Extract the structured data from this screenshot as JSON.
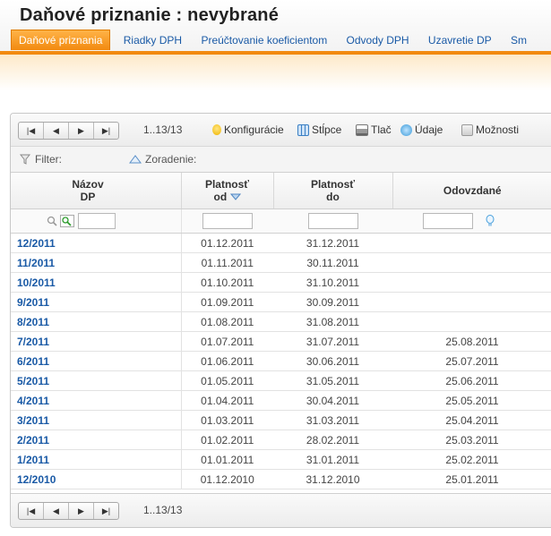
{
  "page": {
    "title": "Daňové priznanie :  nevybrané"
  },
  "tabs": [
    {
      "label": "Daňové priznania",
      "active": true
    },
    {
      "label": "Riadky DPH"
    },
    {
      "label": "Preúčtovanie koeficientom"
    },
    {
      "label": "Odvody DPH"
    },
    {
      "label": "Uzavretie DP"
    },
    {
      "label": "Sm"
    }
  ],
  "toolbar": {
    "range": "1..13/13",
    "config_label": "Konfigurácie",
    "columns_label": "Stĺpce",
    "print_label": "Tlač",
    "data_label": "Údaje",
    "options_label": "Možnosti",
    "pager_icons": [
      "first-page-icon",
      "prev-page-icon",
      "next-page-icon",
      "last-page-icon"
    ]
  },
  "filterbar": {
    "filter_label": "Filter:",
    "sort_label": "Zoradenie:"
  },
  "table": {
    "headers": {
      "name_line1": "Názov",
      "name_line2": "DP",
      "from_line1": "Platnosť",
      "from_line2": "od",
      "to_line1": "Platnosť",
      "to_line2": "do",
      "submitted": "Odovzdané"
    },
    "rows": [
      {
        "name": "12/2011",
        "from": "01.12.2011",
        "to": "31.12.2011",
        "submitted": ""
      },
      {
        "name": "11/2011",
        "from": "01.11.2011",
        "to": "30.11.2011",
        "submitted": ""
      },
      {
        "name": "10/2011",
        "from": "01.10.2011",
        "to": "31.10.2011",
        "submitted": ""
      },
      {
        "name": "9/2011",
        "from": "01.09.2011",
        "to": "30.09.2011",
        "submitted": ""
      },
      {
        "name": "8/2011",
        "from": "01.08.2011",
        "to": "31.08.2011",
        "submitted": ""
      },
      {
        "name": "7/2011",
        "from": "01.07.2011",
        "to": "31.07.2011",
        "submitted": "25.08.2011"
      },
      {
        "name": "6/2011",
        "from": "01.06.2011",
        "to": "30.06.2011",
        "submitted": "25.07.2011"
      },
      {
        "name": "5/2011",
        "from": "01.05.2011",
        "to": "31.05.2011",
        "submitted": "25.06.2011"
      },
      {
        "name": "4/2011",
        "from": "01.04.2011",
        "to": "30.04.2011",
        "submitted": "25.05.2011"
      },
      {
        "name": "3/2011",
        "from": "01.03.2011",
        "to": "31.03.2011",
        "submitted": "25.04.2011"
      },
      {
        "name": "2/2011",
        "from": "01.02.2011",
        "to": "28.02.2011",
        "submitted": "25.03.2011"
      },
      {
        "name": "1/2011",
        "from": "01.01.2011",
        "to": "31.01.2011",
        "submitted": "25.02.2011"
      },
      {
        "name": "12/2010",
        "from": "01.12.2010",
        "to": "31.12.2010",
        "submitted": "25.01.2011"
      }
    ]
  },
  "bottombar": {
    "range": "1..13/13"
  },
  "colors": {
    "accent": "#f28a10",
    "link": "#1a5aa6"
  }
}
